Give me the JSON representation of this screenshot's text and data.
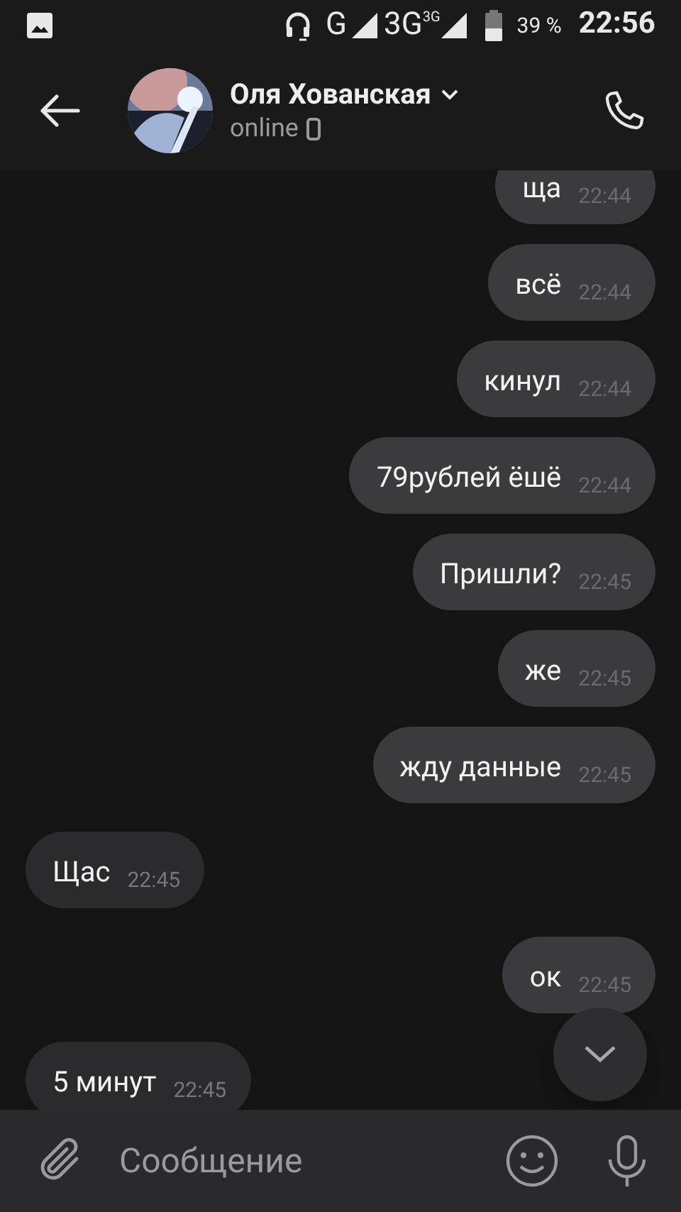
{
  "status_bar": {
    "network_1": "G",
    "network_2": "3G",
    "network_2_sup": "3G",
    "battery": "39 %",
    "time": "22:56"
  },
  "header": {
    "name": "Оля Хованская",
    "status": "online"
  },
  "messages": [
    {
      "text": "ща",
      "time": "22:44",
      "outgoing": true
    },
    {
      "text": "всё",
      "time": "22:44",
      "outgoing": true
    },
    {
      "text": "кинул",
      "time": "22:44",
      "outgoing": true
    },
    {
      "text": "79рублей ёшё",
      "time": "22:44",
      "outgoing": true
    },
    {
      "text": "Пришли?",
      "time": "22:45",
      "outgoing": true
    },
    {
      "text": "же",
      "time": "22:45",
      "outgoing": true
    },
    {
      "text": "жду данные",
      "time": "22:45",
      "outgoing": true
    },
    {
      "text": "Щас",
      "time": "22:45",
      "outgoing": false
    },
    {
      "text": "ок",
      "time": "22:45",
      "outgoing": true
    },
    {
      "text": "5 минут",
      "time": "22:45",
      "outgoing": false
    }
  ],
  "composer": {
    "placeholder": "Сообщение"
  }
}
